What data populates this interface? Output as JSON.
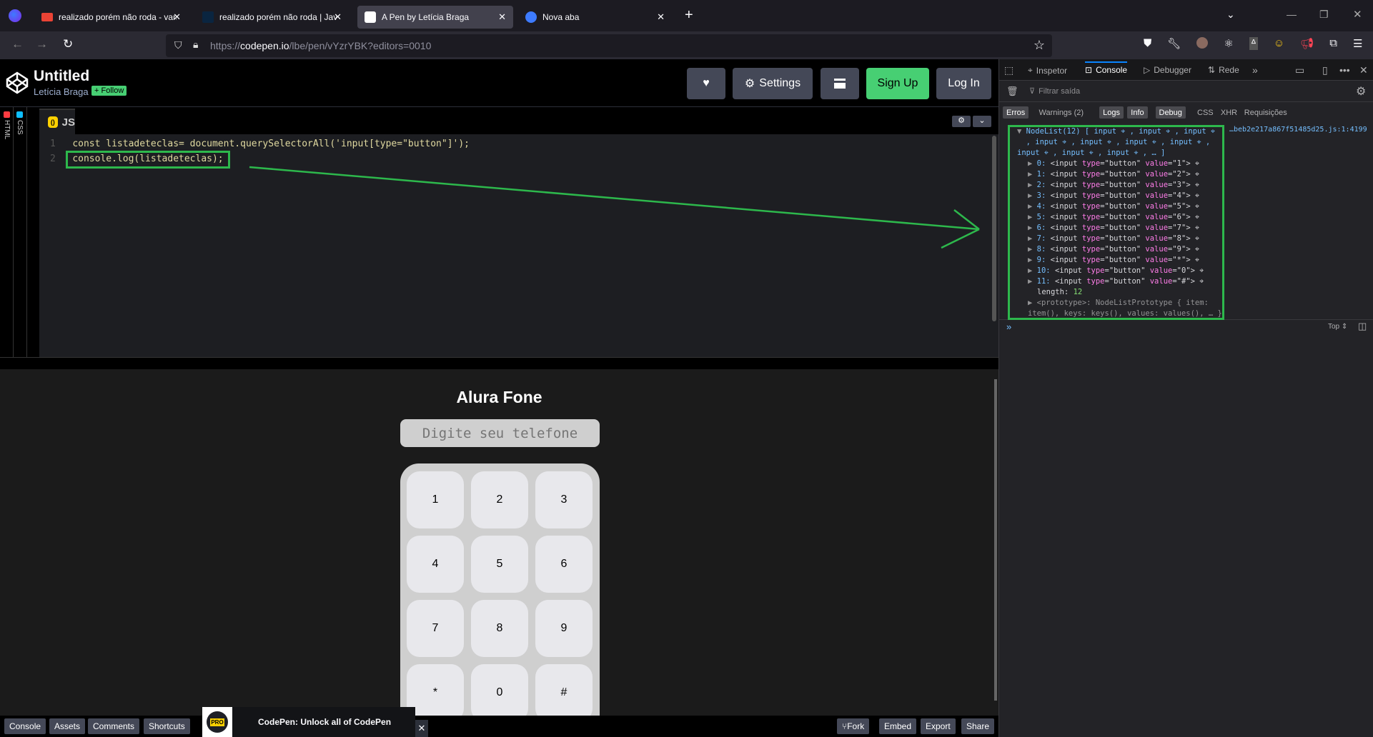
{
  "browser": {
    "tabs": [
      {
        "title": "realizado porém não roda - vam",
        "active": false
      },
      {
        "title": "realizado porém não roda | Java",
        "active": false
      },
      {
        "title": "A Pen by Letícia Braga",
        "active": true
      },
      {
        "title": "Nova aba",
        "active": false
      }
    ],
    "url_prefix": "https://",
    "url_domain": "codepen.io",
    "url_path": "/lbe/pen/vYzrYBK?editors=0010"
  },
  "codepen": {
    "title": "Untitled",
    "author": "Letícia Braga",
    "follow": "+ Follow",
    "settings": "Settings",
    "signup": "Sign Up",
    "login": "Log In",
    "side_tabs": [
      "HTML",
      "CSS"
    ],
    "editor_tab": "JS",
    "code": [
      {
        "num": "1",
        "text": "const listadeteclas= document.querySelectorAll('input[type=\"button\"]');"
      },
      {
        "num": "2",
        "text": "console.log(listadeteclas);"
      }
    ],
    "accent": "#47cf73"
  },
  "preview": {
    "heading": "Alura Fone",
    "placeholder": "Digite seu telefone",
    "keys": [
      "1",
      "2",
      "3",
      "4",
      "5",
      "6",
      "7",
      "8",
      "9",
      "*",
      "0",
      "#"
    ]
  },
  "bottom": {
    "left": [
      "Console",
      "Assets",
      "Comments",
      "Shortcuts"
    ],
    "promo": "CodePen: Unlock all of CodePen",
    "pro": "PRO",
    "right": [
      "Fork",
      "Embed",
      "Export",
      "Share"
    ]
  },
  "devtools": {
    "tabs": [
      "Inspetor",
      "Console",
      "Debugger",
      "Rede"
    ],
    "filter_placeholder": "Filtrar saída",
    "filters": [
      {
        "label": "Erros",
        "on": true
      },
      {
        "label": "Warnings (2)",
        "on": false
      },
      {
        "label": "Logs",
        "on": true
      },
      {
        "label": "Info",
        "on": true
      },
      {
        "label": "Debug",
        "on": true
      },
      {
        "label": "CSS",
        "on": false
      },
      {
        "label": "XHR",
        "on": false
      },
      {
        "label": "Requisições",
        "on": false
      }
    ],
    "source": "…beb2e217a867f51485d25.js:1:4199",
    "summary": [
      "NodeList(12) [ input ⌖ , input ⌖ , input ⌖",
      "  , input ⌖ , input ⌖ , input ⌖ , input ⌖ ,",
      "input ⌖ , input ⌖ , input ⌖ , … ]"
    ],
    "entries": [
      "1",
      "2",
      "3",
      "4",
      "5",
      "6",
      "7",
      "8",
      "9",
      "*",
      "0",
      "#"
    ],
    "length_label": "length: ",
    "length": "12",
    "prototype": [
      "▶ <prototype>: NodeListPrototype { item:",
      "item(), keys: keys(), values: values(), … }"
    ],
    "context": "Top ⇕"
  }
}
